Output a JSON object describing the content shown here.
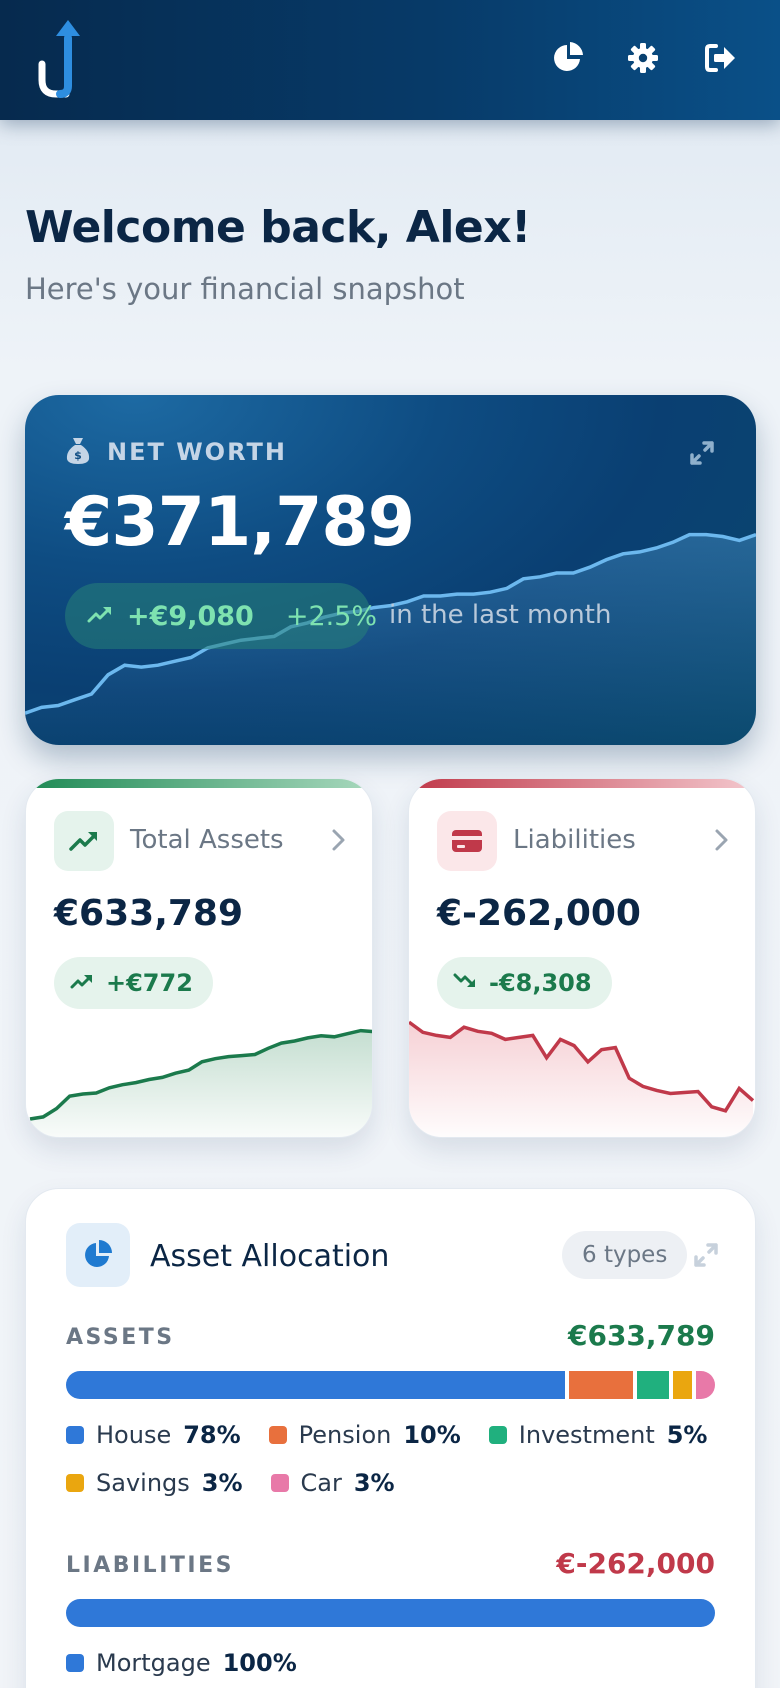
{
  "header": {
    "icons": [
      "app-logo",
      "pie-chart-icon",
      "gear-icon",
      "sign-out-icon"
    ]
  },
  "welcome": {
    "title": "Welcome back, Alex!",
    "subtitle": "Here's your financial snapshot"
  },
  "net_worth": {
    "label": "NET WORTH",
    "value": "€371,789",
    "change_abs": "+€9,080",
    "change_pct": "+2.5%",
    "period": "in the last month",
    "icon": "money-bag-icon",
    "trend": [
      0.02,
      0.05,
      0.06,
      0.09,
      0.12,
      0.22,
      0.27,
      0.26,
      0.27,
      0.29,
      0.31,
      0.36,
      0.38,
      0.4,
      0.41,
      0.42,
      0.47,
      0.49,
      0.52,
      0.54,
      0.55,
      0.57,
      0.58,
      0.6,
      0.63,
      0.63,
      0.64,
      0.64,
      0.65,
      0.67,
      0.72,
      0.73,
      0.75,
      0.75,
      0.78,
      0.82,
      0.85,
      0.86,
      0.88,
      0.91,
      0.95,
      0.95,
      0.94,
      0.92,
      0.95
    ]
  },
  "assets_card": {
    "title": "Total Assets",
    "value": "€633,789",
    "change": "+€772",
    "icon": "trend-up-icon",
    "trend": [
      0.0,
      0.02,
      0.1,
      0.22,
      0.24,
      0.25,
      0.3,
      0.33,
      0.35,
      0.38,
      0.4,
      0.44,
      0.47,
      0.55,
      0.58,
      0.6,
      0.61,
      0.62,
      0.68,
      0.73,
      0.75,
      0.78,
      0.8,
      0.79,
      0.82,
      0.85,
      0.84
    ]
  },
  "liabilities_card": {
    "title": "Liabilities",
    "value": "€-262,000",
    "change": "-€8,308",
    "icon": "credit-card-icon",
    "trend": [
      0.95,
      0.85,
      0.82,
      0.8,
      0.9,
      0.86,
      0.84,
      0.78,
      0.8,
      0.82,
      0.6,
      0.78,
      0.72,
      0.56,
      0.68,
      0.7,
      0.4,
      0.32,
      0.28,
      0.25,
      0.26,
      0.27,
      0.12,
      0.08,
      0.3,
      0.18
    ]
  },
  "allocation": {
    "title": "Asset Allocation",
    "badge": "6 types",
    "assets": {
      "label": "ASSETS",
      "total": "€633,789",
      "total_color": "#1b7a4c",
      "items": [
        {
          "name": "House",
          "pct": "78%",
          "share": 78,
          "color": "#2f78d8"
        },
        {
          "name": "Pension",
          "pct": "10%",
          "share": 10,
          "color": "#e8703d"
        },
        {
          "name": "Investment",
          "pct": "5%",
          "share": 5,
          "color": "#20b07e"
        },
        {
          "name": "Savings",
          "pct": "3%",
          "share": 3,
          "color": "#eaa60f"
        },
        {
          "name": "Car",
          "pct": "3%",
          "share": 3,
          "color": "#e879a8"
        }
      ]
    },
    "liabilities": {
      "label": "LIABILITIES",
      "total": "€-262,000",
      "total_color": "#c0394a",
      "items": [
        {
          "name": "Mortgage",
          "pct": "100%",
          "share": 100,
          "color": "#2f78d8"
        }
      ]
    }
  },
  "colors": {
    "header_dark": "#062a4e",
    "positive": "#1b7a4c",
    "negative": "#c0394a",
    "accent_blue": "#2f78d8"
  }
}
